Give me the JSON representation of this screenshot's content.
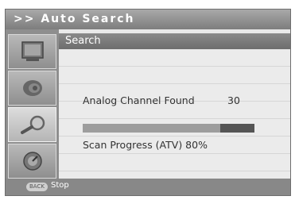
{
  "title": ">> Auto Search",
  "sidebar": {
    "items": [
      {
        "icon": "tv-screen-icon",
        "active": false
      },
      {
        "icon": "speaker-icon",
        "active": false
      },
      {
        "icon": "search-magnifier-icon",
        "active": true
      },
      {
        "icon": "settings-dial-icon",
        "active": false
      }
    ]
  },
  "content": {
    "header": "Search",
    "found_label": "Analog Channel Found",
    "found_count": "30",
    "progress_label": "Scan Progress (ATV) 80%",
    "progress_fraction": 0.8
  },
  "footer": {
    "key": "BACK",
    "action": "Stop"
  }
}
